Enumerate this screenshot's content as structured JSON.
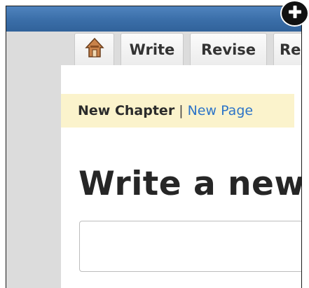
{
  "icons": {
    "home_tab": "home-icon",
    "corner_button": "plus-icon"
  },
  "tabs": [
    {
      "label": "Write"
    },
    {
      "label": "Revise"
    },
    {
      "label": "Re"
    }
  ],
  "subnav": {
    "current": "New Chapter",
    "separator": "|",
    "link": "New Page"
  },
  "main": {
    "heading": "Write a new",
    "title_input_value": ""
  },
  "colors": {
    "top_bar": "#3a6ea8",
    "subnav_background": "#fbf3cc",
    "link": "#2d74c8",
    "canvas": "#dcdcdc"
  }
}
